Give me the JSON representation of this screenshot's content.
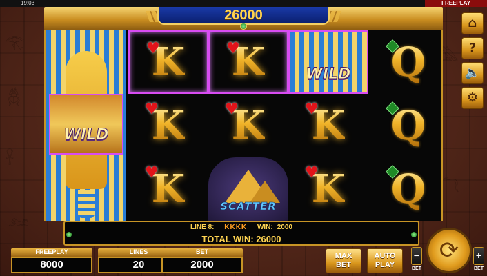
{
  "status_bar": {
    "time": "19:03",
    "mode": "FREEPLAY"
  },
  "balance": {
    "value": "26000"
  },
  "reels": {
    "symbols": {
      "king": "K",
      "queen": "Q",
      "wild": "WILD",
      "scatter": "SCATTER"
    }
  },
  "info": {
    "line_label": "LINE 8:",
    "line_symbols": "KKKK",
    "win_label": "WIN:",
    "win_value": "2000",
    "total_label": "TOTAL WIN:",
    "total_value": "26000"
  },
  "counters": {
    "freeplay": {
      "label": "FREEPLAY",
      "value": "8000"
    },
    "lines": {
      "label": "LINES",
      "value": "20"
    },
    "bet": {
      "label": "BET",
      "value": "2000"
    }
  },
  "buttons": {
    "max_bet": "MAX\nBET",
    "auto_play": "AUTO\nPLAY",
    "bet_minus": "−",
    "bet_plus": "+",
    "bet_minus_label": "BET",
    "bet_plus_label": "BET"
  },
  "side_icons": [
    "home-icon",
    "help-icon",
    "sound-icon",
    "settings-icon"
  ],
  "colors": {
    "accent": "#ffd451",
    "highlight": "#d84cf2",
    "balance_bg": "#1a3aa8"
  }
}
